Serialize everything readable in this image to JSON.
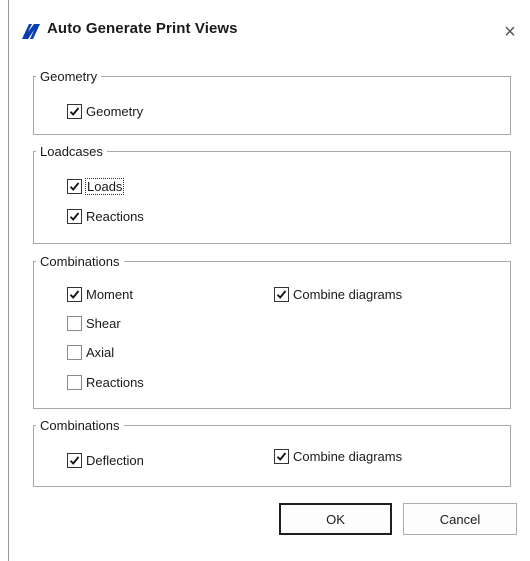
{
  "dialog": {
    "title": "Auto Generate Print Views",
    "close_symbol": "×",
    "logo_icon": "app-logo-icon",
    "accent_color": "#0a3fb0"
  },
  "groups": [
    {
      "legend": "Geometry",
      "items": [
        {
          "label": "Geometry",
          "checked": true
        }
      ]
    },
    {
      "legend": "Loadcases",
      "items": [
        {
          "label": "Loads",
          "checked": true,
          "focused": true
        },
        {
          "label": "Reactions",
          "checked": true
        }
      ]
    },
    {
      "legend": "Combinations",
      "items": [
        {
          "label": "Moment",
          "checked": true
        },
        {
          "label": "Shear",
          "checked": false
        },
        {
          "label": "Axial",
          "checked": false
        },
        {
          "label": "Reactions",
          "checked": false
        }
      ],
      "option": {
        "label": "Combine diagrams",
        "checked": true
      }
    },
    {
      "legend": "Combinations",
      "items": [
        {
          "label": "Deflection",
          "checked": true
        }
      ],
      "option": {
        "label": "Combine diagrams",
        "checked": true
      }
    }
  ],
  "buttons": {
    "ok_label": "OK",
    "cancel_label": "Cancel"
  }
}
